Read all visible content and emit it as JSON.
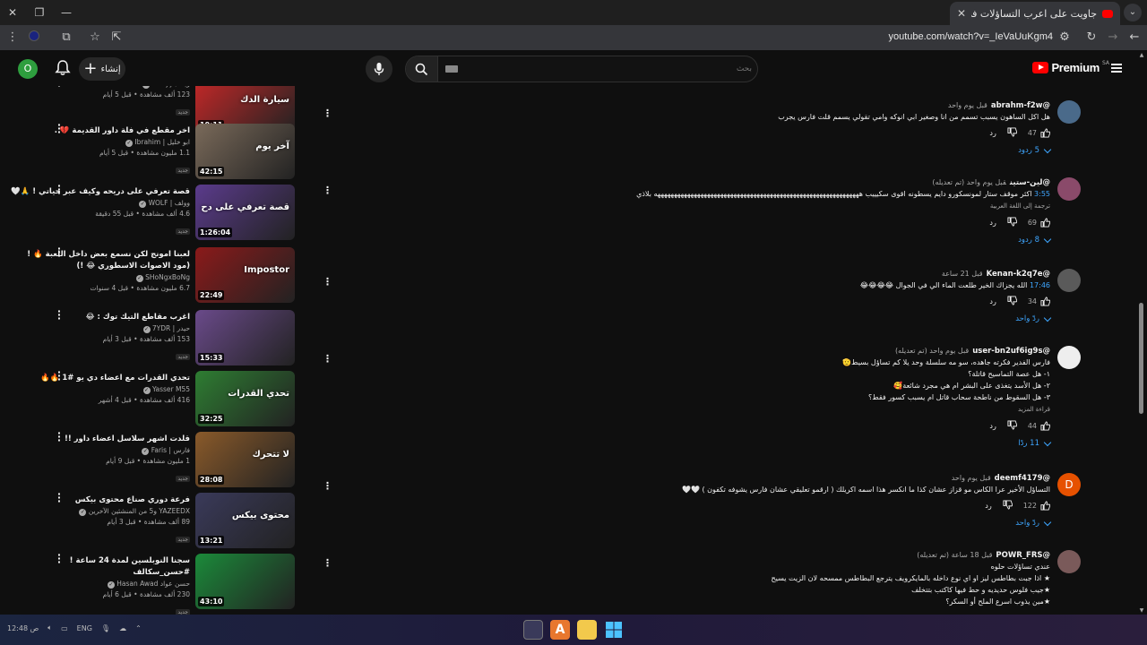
{
  "browser": {
    "tab_title": "جاويت على اعرب التساؤلات في ال",
    "url": "youtube.com/watch?v=_IeVaUuKgm4"
  },
  "header": {
    "avatar_letter": "O",
    "create_label": "إنشاء",
    "search_placeholder": "بحث",
    "logo_text": "Premium",
    "region": "SA"
  },
  "sidebar": {
    "videos": [
      {
        "title": "",
        "channel": "زياد / Skelyy",
        "stats": "123 ألف مشاهدة • قبل 5 أيام",
        "badge": "جديد",
        "duration": "19:11",
        "thumb_color": "#c62828",
        "thumb_text": "سيارة الدك"
      },
      {
        "title": "اخر مقطع في فلة داور القديمة 💔 .",
        "channel": "ابو خليل | Ibrahim",
        "stats": "1.1 مليون مشاهدة • قبل 5 أيام",
        "badge": "جديد",
        "duration": "42:15",
        "thumb_color": "#7a6a5a",
        "thumb_text": "آخر يوم"
      },
      {
        "title": "قصة تعرفي على دريحه وكيف عبر حياتي ! 🙏🤍",
        "channel": "وولف | WOLF",
        "stats": "4.6 ألف مشاهدة • قبل 55 دقيقة",
        "badge": "جديد",
        "duration": "1:26:04",
        "thumb_color": "#5b3b8c",
        "thumb_text": "قصة تعرفي على دح"
      },
      {
        "title": "لعبنا امونج لكن نسمع بعض داخل اللعبة 🔥 ! (مود الاصوات الاسطوري 😂 !)",
        "channel": "SHoNgxBoNg",
        "stats": "6.7 مليون مشاهدة • قبل 4 سنوات",
        "badge": "",
        "duration": "22:49",
        "thumb_color": "#8b1a1a",
        "thumb_text": "Impostor"
      },
      {
        "title": "اغرب مقاطع التيك توك : 😂",
        "channel": "حيدر | 7YDR",
        "stats": "153 ألف مشاهدة • قبل 3 أيام",
        "badge": "جديد",
        "duration": "15:33",
        "thumb_color": "#6a4a8a",
        "thumb_text": ""
      },
      {
        "title": "تحدي القدرات مع اعضاء دي يو #1 🔥🔥",
        "channel": "Yasser M55",
        "stats": "416 ألف مشاهدة • قبل 4 أشهر",
        "badge": "",
        "duration": "32:25",
        "thumb_color": "#2e7d32",
        "thumb_text": "تحدي القدرات"
      },
      {
        "title": "قلدت اشهر سلاسل اعضاء داور !!",
        "channel": "فارس | Faris",
        "stats": "1 مليون مشاهدة • قبل 9 أيام",
        "badge": "جديد",
        "duration": "28:08",
        "thumb_color": "#8a5a2a",
        "thumb_text": "لا تتحرك"
      },
      {
        "title": "فرعة دوري صناع محتوى بيكس",
        "channel": "YAZEEDX و5 من المنشئين الآخرين",
        "stats": "89 ألف مشاهدة • قبل 3 أيام",
        "badge": "جديد",
        "duration": "13:21",
        "thumb_color": "#3a3a5a",
        "thumb_text": "محتوى بيكس"
      },
      {
        "title": "سجنا النوبلسين لمدة 24 ساعة ! #حسن_سكالف",
        "channel": "حسن عواد Hasan Awad",
        "stats": "230 ألف مشاهدة • قبل 6 أيام",
        "badge": "جديد",
        "duration": "43:10",
        "thumb_color": "#1b8a3a",
        "thumb_text": ""
      }
    ]
  },
  "comments": [
    {
      "handle": "@abrahm-f2w",
      "time": "قبل يوم واحد",
      "edited": "",
      "timestamp": "",
      "text": "هل اكل الساهون يسبب تسمم من انا وصغير ابي انوكه وامي تقولي يسمم قلت فارس يجرب",
      "translate": "",
      "read_more": "",
      "likes": "47",
      "reply_label": "رد",
      "replies": "5 ردود",
      "avatar_color": "#4a6a8a"
    },
    {
      "handle": "@لين-ستين",
      "time": "قبل يوم واحد",
      "edited": "(تم تعديله)",
      "timestamp": "3:55",
      "text": "اكثر موقف ستار لمونسكورو دايم يسطونه اقوى سكيييب ههههههههههههههههههههههههههههههههههههههههههههههههههههههههههههههه بلاذي",
      "translate": "ترجمة إلى اللغة العربية",
      "read_more": "",
      "likes": "69",
      "reply_label": "رد",
      "replies": "8 ردود",
      "avatar_color": "#8a4a6a"
    },
    {
      "handle": "@Kenan-k2q7e",
      "time": "قبل 21 ساعة",
      "edited": "",
      "timestamp": "17:46",
      "text": "الله يجزاك الخير طلعت الماء الي في الجوال 😂😂😂😂",
      "translate": "",
      "read_more": "",
      "likes": "34",
      "reply_label": "رد",
      "replies": "ردّ واحد",
      "avatar_color": "#5a5a5a"
    },
    {
      "handle": "@user-bn2uf6ig9s",
      "time": "قبل يوم واحد",
      "edited": "(تم تعديله)",
      "timestamp": "",
      "text": "فارس الفدير فكرته جاهده، سو مه سلسلة وحد يلا كم تساؤل بسيط🫡\n١- هل عصة التماسيح قاتلة؟\n٢- هل الأسد يتغذى على البشر ام هي مجرد شائعة🥰\n٣- هل السقوط من ناطحة سحاب قاتل ام يسبب كسور فقط؟",
      "translate": "",
      "read_more": "قراءة المزيد",
      "likes": "44",
      "reply_label": "رد",
      "replies": "11 ردًا",
      "avatar_color": "#eeeeee"
    },
    {
      "handle": "@deemf4179",
      "time": "قبل يوم واحد",
      "edited": "",
      "timestamp": "",
      "text": "التساؤل الأخير عرا الكاس مو قزاز عشان كذا ما انكسر هذا اسمه اكريلك ( ارقمو تعليقي عشان فارس يشوفه تكفون ) 🤍🤍",
      "translate": "",
      "read_more": "",
      "likes": "122",
      "reply_label": "رد",
      "replies": "ردّ واحد",
      "avatar_color": "#e65100",
      "avatar_letter": "D"
    },
    {
      "handle": "@POWR_FRS",
      "time": "قبل 18 ساعة",
      "edited": "(تم تعديله)",
      "timestamp": "",
      "text": "عندي تساؤلات حلوه\n★ اذا جبت بطاطس ليز او اي نوع داخله بالمايكرويف يترجع البطاطس ممسحه لان الزيت يسيح\n★جيب فلوس حديديه و حط فيها كاكتب بتتخلف\n★مين يذوب اسرع الملح أو السكر؟",
      "translate": "",
      "read_more": "",
      "likes": "",
      "reply_label": "",
      "replies": "",
      "avatar_color": "#7a5a5a"
    }
  ],
  "taskbar": {
    "tray_lang": "ENG",
    "clock": "12:48 ص"
  },
  "colors": {
    "accent_blue": "#3ea6ff",
    "brand_red": "#ff0000",
    "bg": "#0f0f0f"
  }
}
